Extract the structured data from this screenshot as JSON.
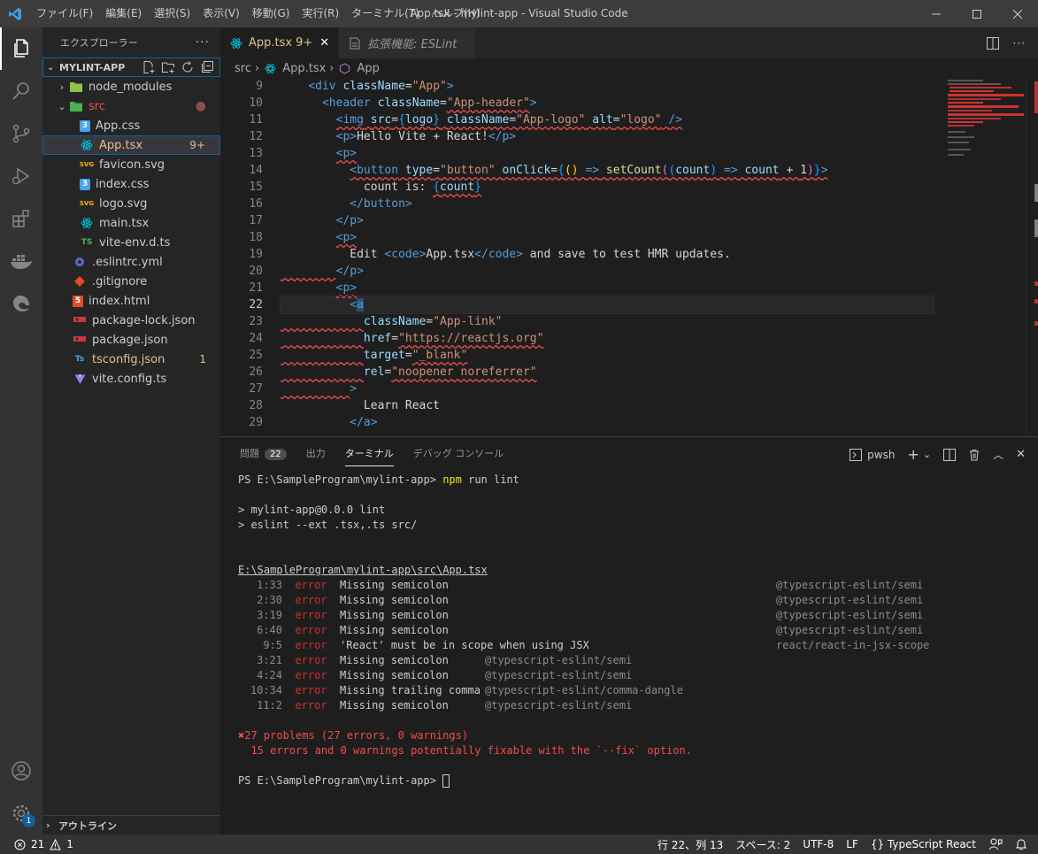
{
  "window": {
    "title": "App.tsx - mylint-app - Visual Studio Code",
    "menu": [
      "ファイル(F)",
      "編集(E)",
      "選択(S)",
      "表示(V)",
      "移動(G)",
      "実行(R)",
      "ターミナル(T)",
      "ヘルプ(H)"
    ]
  },
  "sidebar": {
    "header": "エクスプローラー",
    "project": "MYLINT-APP",
    "tree": [
      {
        "name": "node_modules",
        "type": "folder",
        "open": false,
        "icon": "folder-node-icon",
        "color": "#8bc34a"
      },
      {
        "name": "src",
        "type": "folder",
        "open": true,
        "icon": "folder-src-icon",
        "color": "#f14c4c"
      },
      {
        "name": "App.css",
        "type": "file",
        "icon": "css-file-icon",
        "color": "#42a5f5"
      },
      {
        "name": "App.tsx",
        "type": "file",
        "icon": "react-file-icon",
        "color": "#e2c08d",
        "badge": "9+",
        "selected": true
      },
      {
        "name": "favicon.svg",
        "type": "file",
        "icon": "svg-file-icon",
        "color": "#cccccc"
      },
      {
        "name": "index.css",
        "type": "file",
        "icon": "css-file-icon",
        "color": "#cccccc"
      },
      {
        "name": "logo.svg",
        "type": "file",
        "icon": "svg-file-icon",
        "color": "#cccccc"
      },
      {
        "name": "main.tsx",
        "type": "file",
        "icon": "react-file-icon",
        "color": "#cccccc"
      },
      {
        "name": "vite-env.d.ts",
        "type": "file",
        "icon": "ts-file-icon",
        "color": "#cccccc"
      },
      {
        "name": ".eslintrc.yml",
        "type": "file",
        "icon": "eslint-file-icon",
        "color": "#cccccc"
      },
      {
        "name": ".gitignore",
        "type": "file",
        "icon": "git-file-icon",
        "color": "#cccccc"
      },
      {
        "name": "index.html",
        "type": "file",
        "icon": "html-file-icon",
        "color": "#cccccc"
      },
      {
        "name": "package-lock.json",
        "type": "file",
        "icon": "npm-file-icon",
        "color": "#cccccc"
      },
      {
        "name": "package.json",
        "type": "file",
        "icon": "npm-file-icon",
        "color": "#cccccc"
      },
      {
        "name": "tsconfig.json",
        "type": "file",
        "icon": "tsconfig-file-icon",
        "color": "#e2c08d",
        "badge": "1"
      },
      {
        "name": "vite.config.ts",
        "type": "file",
        "icon": "vite-file-icon",
        "color": "#cccccc"
      }
    ],
    "outline": "アウトライン"
  },
  "tabs": [
    {
      "label": "App.tsx",
      "badge": "9+",
      "active": true
    },
    {
      "label": "拡張機能: ESLint",
      "active": false
    }
  ],
  "breadcrumb": [
    "src",
    "App.tsx",
    "App"
  ],
  "editor": {
    "line_numbers": [
      "9",
      "10",
      "11",
      "12",
      "13",
      "14",
      "15",
      "16",
      "17",
      "18",
      "19",
      "20",
      "21",
      "22",
      "23",
      "24",
      "25",
      "26",
      "27",
      "28",
      "29"
    ]
  },
  "panel": {
    "tabs": [
      {
        "label": "問題",
        "badge": "22"
      },
      {
        "label": "出力"
      },
      {
        "label": "ターミナル",
        "active": true
      },
      {
        "label": "デバッグ コンソール"
      }
    ],
    "shell": "pwsh",
    "prompt": "PS E:\\SampleProgram\\mylint-app> ",
    "command": "npm",
    "command_args": " run lint",
    "script_lines": [
      "> mylint-app@0.0.0 lint",
      "> eslint --ext .tsx,.ts src/"
    ],
    "file_path": "E:\\SampleProgram\\mylint-app\\src\\App.tsx",
    "errors": [
      {
        "loc": "1:33",
        "level": "error",
        "msg": "Missing semicolon",
        "rule": "@typescript-eslint/semi"
      },
      {
        "loc": "2:30",
        "level": "error",
        "msg": "Missing semicolon",
        "rule": "@typescript-eslint/semi"
      },
      {
        "loc": "3:19",
        "level": "error",
        "msg": "Missing semicolon",
        "rule": "@typescript-eslint/semi"
      },
      {
        "loc": "6:40",
        "level": "error",
        "msg": "Missing semicolon",
        "rule": "@typescript-eslint/semi"
      },
      {
        "loc": "9:5",
        "level": "error",
        "msg": "'React' must be in scope when using JSX",
        "rule": "react/react-in-jsx-scope"
      },
      {
        "loc": "3:21",
        "level": "error",
        "msg": "Missing semicolon",
        "rule": "@typescript-eslint/semi"
      },
      {
        "loc": "4:24",
        "level": "error",
        "msg": "Missing semicolon",
        "rule": "@typescript-eslint/semi"
      },
      {
        "loc": "10:34",
        "level": "error",
        "msg": "Missing trailing comma",
        "rule": "@typescript-eslint/comma-dangle"
      },
      {
        "loc": "11:2",
        "level": "error",
        "msg": "Missing semicolon",
        "rule": "@typescript-eslint/semi"
      }
    ],
    "summary": "✖27 problems (27 errors, 0 warnings)",
    "fixable": "  15 errors and 0 warnings potentially fixable with the `--fix` option.",
    "final_prompt": "PS E:\\SampleProgram\\mylint-app> "
  },
  "statusbar": {
    "errors": "21",
    "warnings": "1",
    "position": "行 22、列 13",
    "spaces": "スペース: 2",
    "encoding": "UTF-8",
    "eol": "LF",
    "language": "TypeScript React",
    "braces": "{}"
  },
  "activity_badge": "1"
}
